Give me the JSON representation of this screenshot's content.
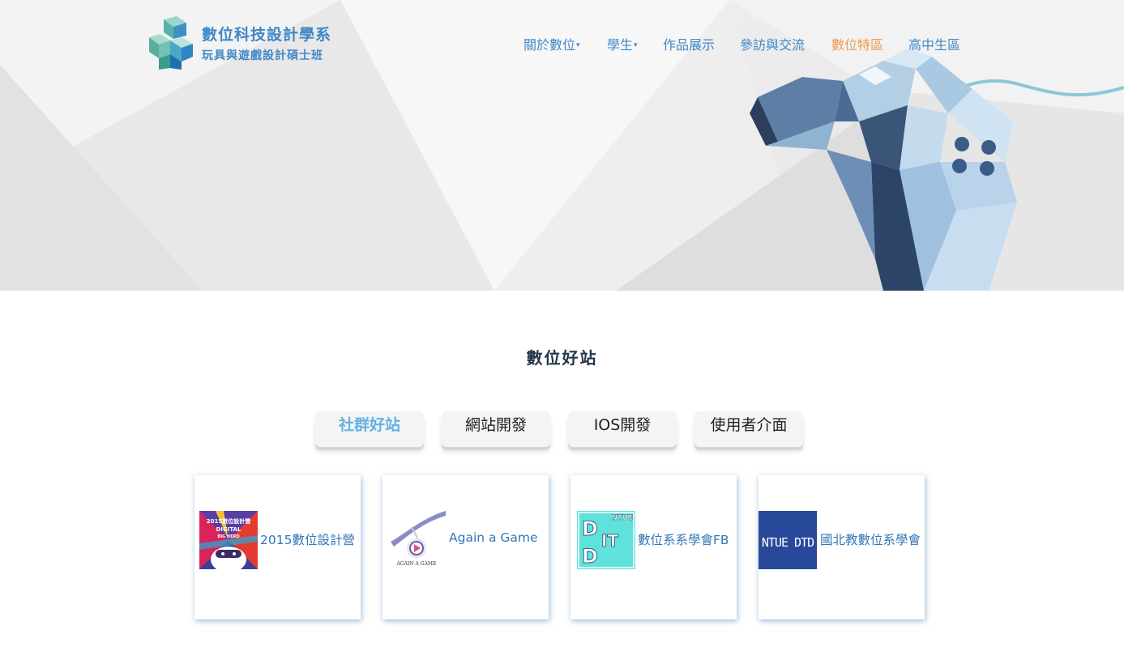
{
  "site": {
    "title": "數位科技設計學系",
    "subtitle": "玩具與遊戲設計碩士班",
    "logo_icon": "cube-logo-icon"
  },
  "nav": {
    "items": [
      {
        "label": "關於數位",
        "dropdown": true,
        "active": false
      },
      {
        "label": "學生",
        "dropdown": true,
        "active": false
      },
      {
        "label": "作品展示",
        "dropdown": false,
        "active": false
      },
      {
        "label": "參訪與交流",
        "dropdown": false,
        "active": false
      },
      {
        "label": "數位特區",
        "dropdown": false,
        "active": true
      },
      {
        "label": "高中生區",
        "dropdown": false,
        "active": false
      }
    ],
    "caret": "▾"
  },
  "hero": {
    "image": "game-controller-illustration"
  },
  "section": {
    "title": "數位好站"
  },
  "tabs": [
    {
      "label": "社群好站",
      "active": true
    },
    {
      "label": "網站開發",
      "active": false
    },
    {
      "label": "IOS開發",
      "active": false
    },
    {
      "label": "使用者介面",
      "active": false
    }
  ],
  "cards": [
    {
      "label": "2015數位設計營",
      "thumb_text_1": "2015數位設計營",
      "thumb_text_2": "DIGITAL",
      "thumb_text_3": "BIG HERO"
    },
    {
      "label": "Again a Game",
      "thumb_text_1": "AGAIN A GAME"
    },
    {
      "label": "數位系系學會FB",
      "thumb_text_1": "NTUE",
      "thumb_text_2": "D",
      "thumb_text_3": "IT",
      "thumb_text_4": "D"
    },
    {
      "label": "國北教數位系學會",
      "thumb_text_1": "NTUE DTD"
    }
  ],
  "colors": {
    "nav": "#3f87c7",
    "nav_active": "#ee9a4d",
    "tab_active": "#62b2e2",
    "card_text": "#3176b8",
    "title": "#24354a"
  }
}
